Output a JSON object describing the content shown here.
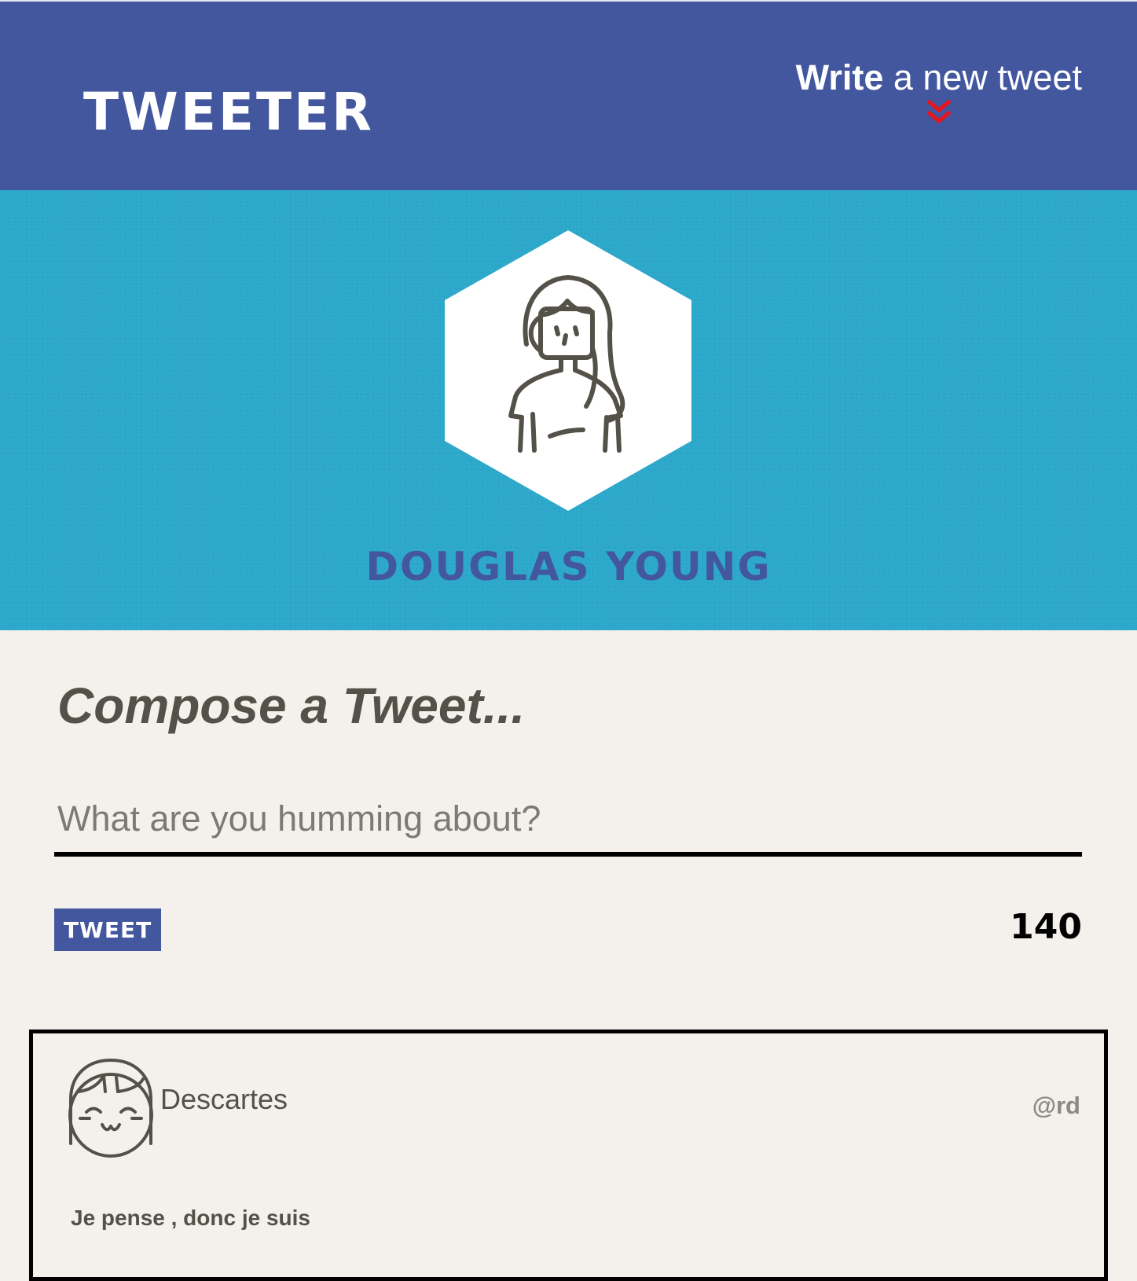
{
  "nav": {
    "logo": "TWEETER",
    "compose_toggle_bold": "Write",
    "compose_toggle_rest": " a new tweet",
    "chevron_color": "#e8141c",
    "background": "#43579f"
  },
  "profile": {
    "name": "Douglas Young",
    "banner_color": "#2ca8ca",
    "avatar_icon": "woman-avatar-icon"
  },
  "compose": {
    "title": "Compose a Tweet...",
    "placeholder": "What are you humming about?",
    "value": "",
    "submit_label": "TWEET",
    "char_counter": "140"
  },
  "tweets": [
    {
      "author": "Descartes",
      "handle": "@rd",
      "content": "Je pense , donc je suis",
      "avatar_icon": "smiling-girl-avatar-icon"
    }
  ]
}
